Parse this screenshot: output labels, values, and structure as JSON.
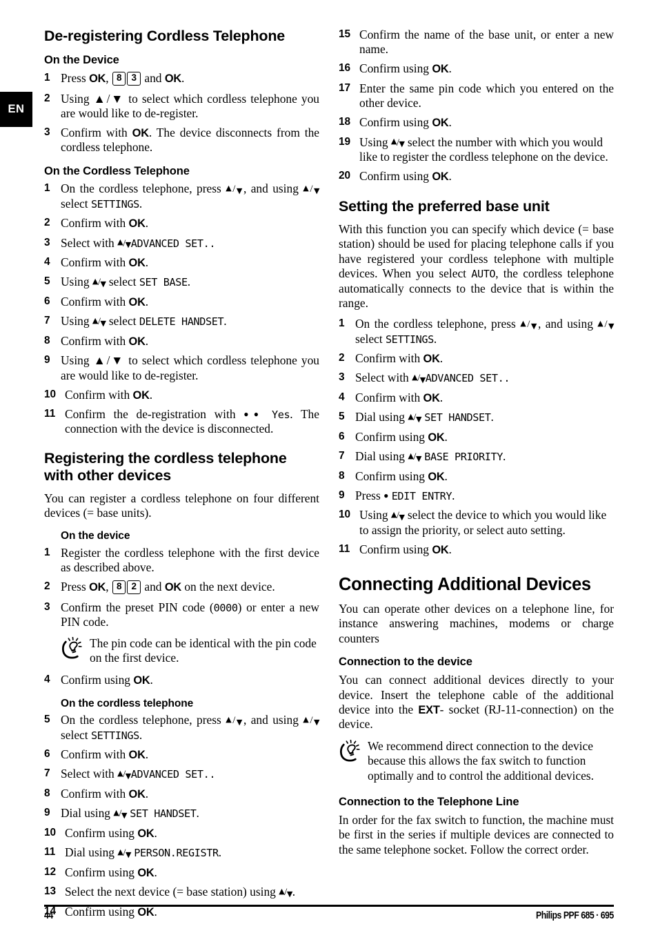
{
  "page": {
    "language_tab": "EN",
    "footer": {
      "page_number": "44",
      "book_title": "Philips PPF 685 · 695"
    }
  },
  "left_column": {
    "section_1": {
      "title": "De-registering Cordless Telephone",
      "subsection_device": {
        "title": "On the Device",
        "steps": [
          {
            "num": "1",
            "text_parts": [
              "Press ",
              "OK",
              ", ",
              "8",
              "3",
              " and ",
              "OK",
              "."
            ]
          },
          {
            "num": "2",
            "text": "Using ▲/▼ to select which cordless telephone you are would like to de-register."
          },
          {
            "num": "3",
            "text": "Confirm with OK. The device disconnects from the cordless telephone."
          }
        ]
      },
      "subsection_cordless": {
        "title": "On the Cordless Telephone",
        "steps": [
          {
            "num": "1",
            "pre": "On the cordless telephone, press ▲/▼, and using ▲/▼ select ",
            "lcd": "SETTINGS",
            "post": "."
          },
          {
            "num": "2",
            "pre": "Confirm with ",
            "ok": "OK",
            "post": "."
          },
          {
            "num": "3",
            "pre": "Select with ▲/▼",
            "lcd": "ADVANCED SET..",
            "post": ""
          },
          {
            "num": "4",
            "pre": "Confirm with ",
            "ok": "OK",
            "post": "."
          },
          {
            "num": "5",
            "pre": "Using ▲/▼ select ",
            "lcd": "SET BASE",
            "post": "."
          },
          {
            "num": "6",
            "pre": "Confirm with ",
            "ok": "OK",
            "post": "."
          },
          {
            "num": "7",
            "pre": "Using ▲/▼ select ",
            "lcd": "DELETE HANDSET",
            "post": "."
          },
          {
            "num": "8",
            "pre": "Confirm with ",
            "ok": "OK",
            "post": "."
          },
          {
            "num": "9",
            "text": "Using ▲/▼ to select which cordless telephone you are would like to de-register."
          },
          {
            "num": "10",
            "pre": "Confirm with ",
            "ok": "OK",
            "post": "."
          },
          {
            "num": "11",
            "pre": "Confirm the de-registration with ●● ",
            "lcd": "Yes",
            "post": ". The connection with the device is disconnected."
          }
        ]
      }
    },
    "section_2": {
      "title": "Registering the cordless telephone with other devices",
      "intro": "You can register a cordless telephone on four different devices (= base units).",
      "subsection_device": {
        "title": "On the device",
        "steps": [
          {
            "num": "1",
            "text": "Register the cordless telephone with the first device as described above."
          },
          {
            "num": "2",
            "text_parts": [
              "Press ",
              "OK",
              ", ",
              "8",
              "2",
              " and ",
              "OK",
              " on the next device."
            ]
          },
          {
            "num": "3",
            "pre": "Confirm the preset PIN code (",
            "lcd": "0000",
            "post": ") or enter a new PIN code."
          }
        ],
        "tip": "The pin code can be identical with the pin code on the first device.",
        "step_after_tip": {
          "num": "4",
          "pre": "Confirm using ",
          "ok": "OK",
          "post": "."
        }
      },
      "subsection_cordless": {
        "title": "On the cordless telephone",
        "steps": [
          {
            "num": "5",
            "pre": "On the cordless telephone, press ▲/▼, and using ▲/▼ select ",
            "lcd": "SETTINGS",
            "post": "."
          },
          {
            "num": "6",
            "pre": "Confirm with ",
            "ok": "OK",
            "post": "."
          },
          {
            "num": "7",
            "pre": "Select with ▲/▼",
            "lcd": "ADVANCED SET..",
            "post": ""
          },
          {
            "num": "8",
            "pre": "Confirm with ",
            "ok": "OK",
            "post": "."
          },
          {
            "num": "9",
            "pre": "Dial using ▲/▼ ",
            "lcd": "SET HANDSET",
            "post": "."
          },
          {
            "num": "10",
            "pre": "Confirm using ",
            "ok": "OK",
            "post": "."
          },
          {
            "num": "11",
            "pre": "Dial using ▲/▼ ",
            "lcd": "PERSON.REGISTR",
            "post": "."
          },
          {
            "num": "12",
            "pre": "Confirm using ",
            "ok": "OK",
            "post": "."
          },
          {
            "num": "13",
            "text": "Select the next device (= base station) using ▲/▼."
          },
          {
            "num": "14",
            "pre": "Confirm using ",
            "ok": "OK",
            "post": "."
          }
        ]
      }
    }
  },
  "right_column": {
    "continued_steps": [
      {
        "num": "15",
        "text": "Confirm the name of the base unit, or enter a new name."
      },
      {
        "num": "16",
        "pre": "Confirm using ",
        "ok": "OK",
        "post": "."
      },
      {
        "num": "17",
        "text": "Enter the same pin code which you entered on the other device."
      },
      {
        "num": "18",
        "pre": "Confirm using ",
        "ok": "OK",
        "post": "."
      },
      {
        "num": "19",
        "text": "Using ▲/▼ select the number with which you would like to register the cordless telephone on the device."
      },
      {
        "num": "20",
        "pre": "Confirm using ",
        "ok": "OK",
        "post": "."
      }
    ],
    "section_preferred_base": {
      "title": "Setting the preferred base unit",
      "intro_pre": "With this function you can specify which device (= base station) should be used for placing telephone calls if you have registered your cordless telephone with multiple devices. When you select ",
      "intro_lcd": "AUTO",
      "intro_post": ", the cordless telephone automatically connects to the device that is within the range.",
      "steps": [
        {
          "num": "1",
          "pre": "On the cordless telephone, press ▲/▼, and using ▲/▼ select ",
          "lcd": "SETTINGS",
          "post": "."
        },
        {
          "num": "2",
          "pre": "Confirm with ",
          "ok": "OK",
          "post": "."
        },
        {
          "num": "3",
          "pre": "Select with ▲/▼",
          "lcd": "ADVANCED SET..",
          "post": ""
        },
        {
          "num": "4",
          "pre": "Confirm with ",
          "ok": "OK",
          "post": "."
        },
        {
          "num": "5",
          "pre": "Dial using ▲/▼ ",
          "lcd": "SET HANDSET",
          "post": "."
        },
        {
          "num": "6",
          "pre": "Confirm using ",
          "ok": "OK",
          "post": "."
        },
        {
          "num": "7",
          "pre": "Dial using ▲/▼ ",
          "lcd": "BASE PRIORITY",
          "post": "."
        },
        {
          "num": "8",
          "pre": "Confirm using ",
          "ok": "OK",
          "post": "."
        },
        {
          "num": "9",
          "pre": "Press ● ",
          "lcd": "EDIT ENTRY",
          "post": "."
        },
        {
          "num": "10",
          "text": "Using ▲/▼ select the device to which you would like to assign the priority, or select auto setting."
        },
        {
          "num": "11",
          "pre": "Confirm using ",
          "ok": "OK",
          "post": "."
        }
      ]
    },
    "section_connecting": {
      "title": "Connecting Additional Devices",
      "intro": "You can operate other devices on a telephone line, for instance answering machines, modems or charge counters",
      "subsection_device": {
        "title": "Connection to the device",
        "text_pre": "You can connect additional devices directly to your device. Insert the telephone cable of the additional device into the ",
        "text_bold": "EXT",
        "text_post": "- socket (RJ-11-connection) on the device.",
        "tip": "We recommend direct connection to the device because this allows the fax switch to function optimally and to control the additional devices."
      },
      "subsection_line": {
        "title": "Connection to the Telephone Line",
        "text": "In order for the fax switch to function, the machine must be first in the series if multiple devices are connected to the same telephone socket. Follow the correct order."
      }
    }
  }
}
